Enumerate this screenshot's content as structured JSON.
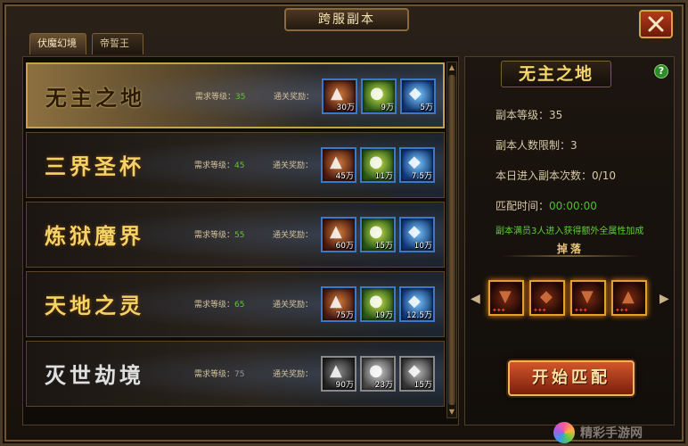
{
  "window": {
    "title": "跨服副本"
  },
  "tabs": [
    {
      "label": "伏魔幻境",
      "active": true
    },
    {
      "label": "帝誓王陵",
      "active": false
    }
  ],
  "dungeons": [
    {
      "name": "无主之地",
      "req_label": "需求等级：",
      "level": "35",
      "reward_label": "通关奖励：",
      "rewards": [
        {
          "icon": "exp-scroll-icon",
          "count": "30万"
        },
        {
          "icon": "gold-coins-icon",
          "count": "9万"
        },
        {
          "icon": "spirit-crystal-icon",
          "count": "5万"
        }
      ],
      "selected": true,
      "disabled": false
    },
    {
      "name": "三界圣杯",
      "req_label": "需求等级：",
      "level": "45",
      "reward_label": "通关奖励：",
      "rewards": [
        {
          "icon": "exp-scroll-icon",
          "count": "45万"
        },
        {
          "icon": "gold-coins-icon",
          "count": "11万"
        },
        {
          "icon": "spirit-crystal-icon",
          "count": "7.5万"
        }
      ],
      "selected": false,
      "disabled": false
    },
    {
      "name": "炼狱魔界",
      "req_label": "需求等级：",
      "level": "55",
      "reward_label": "通关奖励：",
      "rewards": [
        {
          "icon": "exp-scroll-icon",
          "count": "60万"
        },
        {
          "icon": "gold-coins-icon",
          "count": "15万"
        },
        {
          "icon": "spirit-crystal-icon",
          "count": "10万"
        }
      ],
      "selected": false,
      "disabled": false
    },
    {
      "name": "天地之灵",
      "req_label": "需求等级：",
      "level": "65",
      "reward_label": "通关奖励：",
      "rewards": [
        {
          "icon": "exp-scroll-icon",
          "count": "75万"
        },
        {
          "icon": "gold-coins-icon",
          "count": "19万"
        },
        {
          "icon": "spirit-crystal-icon",
          "count": "12.5万"
        }
      ],
      "selected": false,
      "disabled": false
    },
    {
      "name": "灭世劫境",
      "req_label": "需求等级：",
      "level": "75",
      "reward_label": "通关奖励：",
      "rewards": [
        {
          "icon": "exp-scroll-icon",
          "count": "90万"
        },
        {
          "icon": "gold-coins-icon",
          "count": "23万"
        },
        {
          "icon": "spirit-crystal-icon",
          "count": "15万"
        }
      ],
      "selected": false,
      "disabled": true
    }
  ],
  "detail": {
    "title": "无主之地",
    "level_label": "副本等级：",
    "level_value": "35",
    "limit_label": "副本人数限制：",
    "limit_value": "3",
    "entries_label": "本日进入副本次数：",
    "entries_value": "0/10",
    "match_label": "匹配时间：",
    "match_value": "00:00:00",
    "bonus": "副本满员3人进入获得额外全属性加成",
    "drop_title": "掉落",
    "drops": [
      {
        "icon": "armor-icon"
      },
      {
        "icon": "helmet-icon"
      },
      {
        "icon": "armor-icon"
      },
      {
        "icon": "boots-icon"
      }
    ],
    "start_label": "开始匹配"
  },
  "watermark": "精彩手游网"
}
